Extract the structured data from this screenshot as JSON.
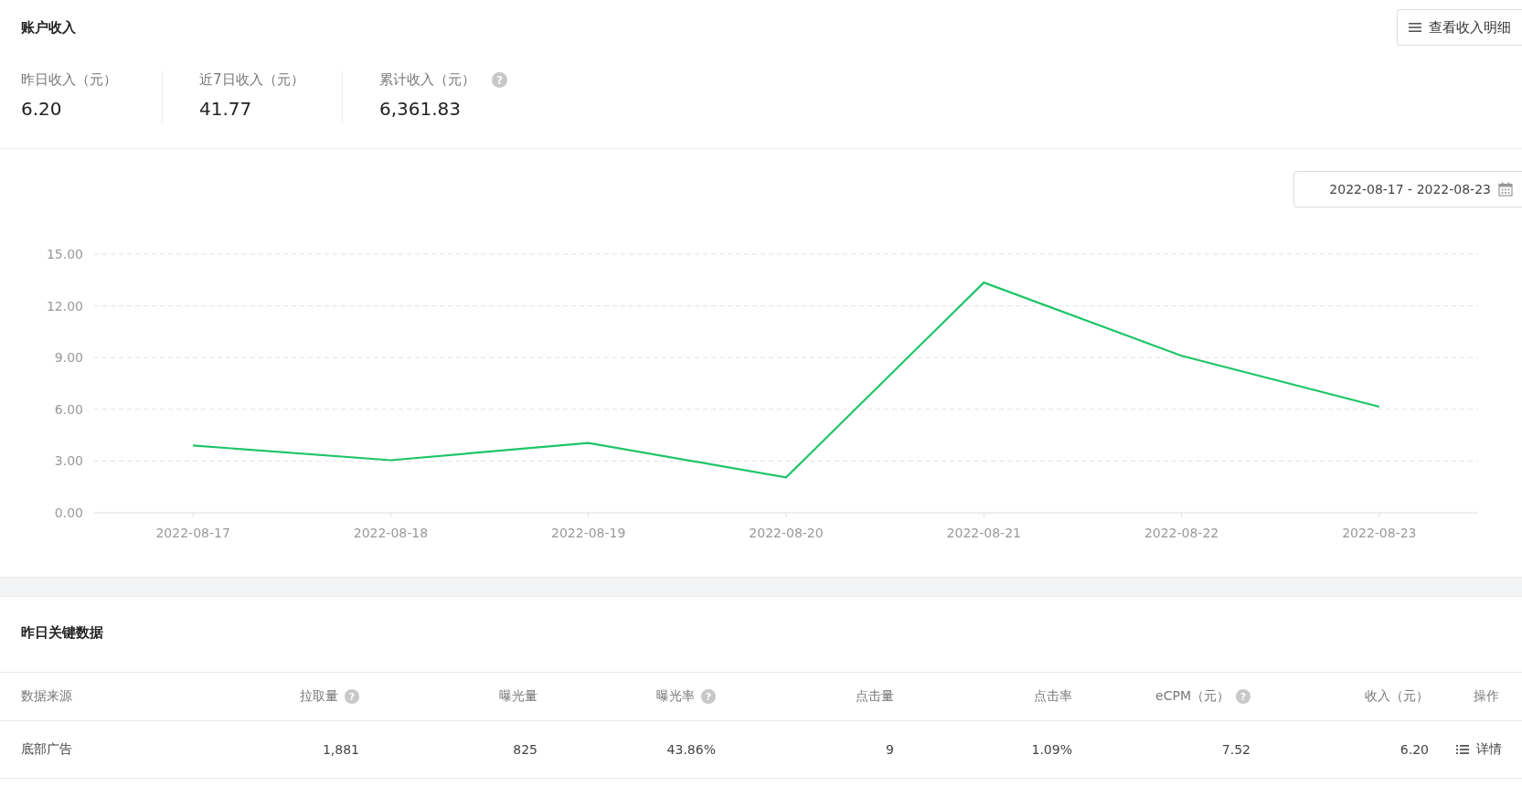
{
  "account": {
    "title": "账户收入",
    "detail_button": {
      "label": "查看收入明细"
    },
    "stats": [
      {
        "label": "昨日收入（元）",
        "value": "6.20"
      },
      {
        "label": "近7日收入（元）",
        "value": "41.77"
      },
      {
        "label": "累计收入（元）",
        "value": "6,361.83",
        "help_icon": "?"
      }
    ]
  },
  "trend": {
    "date_range": "2022-08-17 - 2022-08-23",
    "chart_data": {
      "type": "line",
      "categories": [
        "2022-08-17",
        "2022-08-18",
        "2022-08-19",
        "2022-08-20",
        "2022-08-21",
        "2022-08-22",
        "2022-08-23"
      ],
      "ylim": [
        0,
        15
      ],
      "grid": true,
      "yticks": [
        {
          "value": 0,
          "label": "0.00"
        },
        {
          "value": 3,
          "label": "3.00"
        },
        {
          "value": 6,
          "label": "6.00"
        },
        {
          "value": 9,
          "label": "9.00"
        },
        {
          "value": 12,
          "label": "12.00"
        },
        {
          "value": 15,
          "label": "15.00"
        }
      ],
      "series": [
        {
          "color": "#1ec568",
          "values": [
            3.9,
            3.05,
            4.05,
            2.05,
            13.35,
            9.1,
            6.15
          ]
        }
      ]
    }
  },
  "key_data": {
    "title": "昨日关键数据",
    "columns": [
      {
        "label": "数据来源"
      },
      {
        "label": "拉取量",
        "help_icon": "?"
      },
      {
        "label": "曝光量"
      },
      {
        "label": "曝光率",
        "help_icon": "?"
      },
      {
        "label": "点击量"
      },
      {
        "label": "点击率"
      },
      {
        "label": "eCPM（元）",
        "help_icon": "?"
      },
      {
        "label": "收入（元）"
      },
      {
        "label": "操作"
      }
    ],
    "rows": [
      {
        "cells": [
          "底部广告",
          "1,881",
          "825",
          "43.86%",
          "9",
          "1.09%",
          "7.52",
          "6.20"
        ],
        "action": "详情"
      }
    ]
  }
}
